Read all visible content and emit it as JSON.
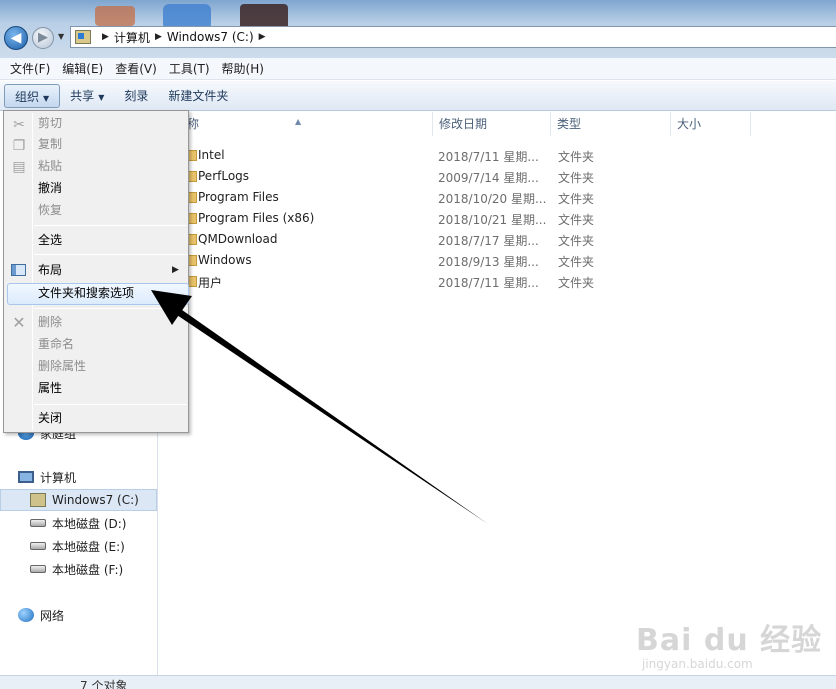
{
  "address": {
    "crumbs": [
      "计算机",
      "Windows7 (C:)"
    ]
  },
  "menubar": [
    "文件(F)",
    "编辑(E)",
    "查看(V)",
    "工具(T)",
    "帮助(H)"
  ],
  "commandbar": {
    "organize": "组织",
    "share": "共享",
    "burn": "刻录",
    "new_folder": "新建文件夹"
  },
  "context_menu": {
    "cut": "剪切",
    "copy": "复制",
    "paste": "粘贴",
    "undo": "撤消",
    "redo": "恢复",
    "select_all": "全选",
    "layout": "布局",
    "folder_options": "文件夹和搜索选项",
    "delete": "删除",
    "rename": "重命名",
    "remove_properties": "删除属性",
    "properties": "属性",
    "close": "关闭"
  },
  "navpane": {
    "homegroup_partial": "家庭组",
    "computer": "计算机",
    "drives": [
      "Windows7 (C:)",
      "本地磁盘 (D:)",
      "本地磁盘 (E:)",
      "本地磁盘 (F:)"
    ],
    "network": "网络"
  },
  "columns": {
    "name": "称",
    "modified": "修改日期",
    "type": "类型",
    "size": "大小"
  },
  "files": [
    {
      "name": "Intel",
      "date": "2018/7/11 星期...",
      "type": "文件夹"
    },
    {
      "name": "PerfLogs",
      "date": "2009/7/14 星期...",
      "type": "文件夹"
    },
    {
      "name": "Program Files",
      "date": "2018/10/20 星期...",
      "type": "文件夹"
    },
    {
      "name": "Program Files (x86)",
      "date": "2018/10/21 星期...",
      "type": "文件夹"
    },
    {
      "name": "QMDownload",
      "date": "2018/7/17 星期...",
      "type": "文件夹"
    },
    {
      "name": "Windows",
      "date": "2018/9/13 星期...",
      "type": "文件夹"
    },
    {
      "name": "用户",
      "date": "2018/7/11 星期...",
      "type": "文件夹"
    }
  ],
  "status": {
    "count": "7 个对象"
  },
  "watermark": {
    "logo": "Bai du 经验",
    "url": "jingyan.baidu.com"
  },
  "colors": {
    "accent": "#1e395b",
    "highlight": "#dcebfc",
    "folder": "#e9c36a"
  }
}
